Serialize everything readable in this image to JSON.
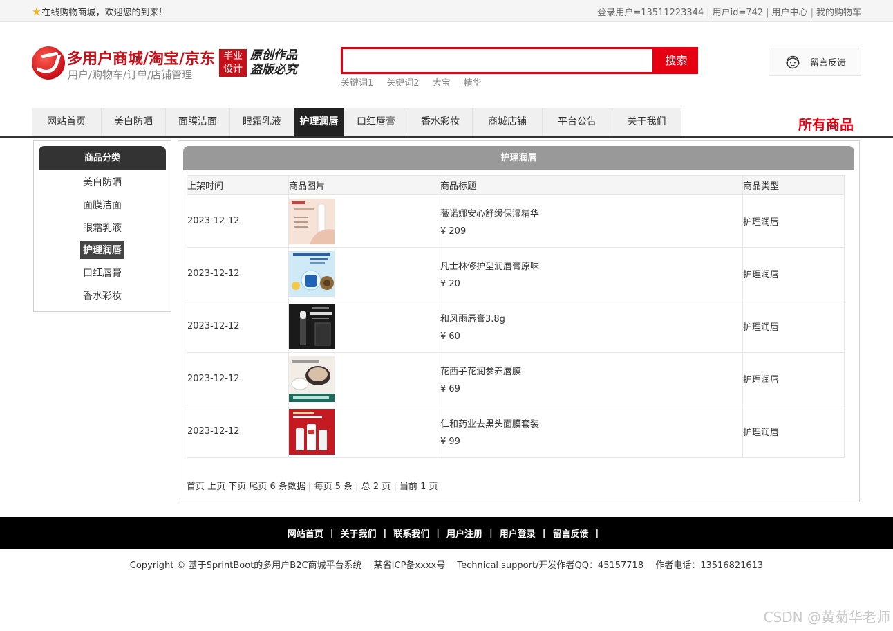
{
  "topbar": {
    "welcome": "在线购物商城，欢迎您的到来!",
    "login_user": "登录用户=13511223344",
    "user_id": "用户id=742",
    "user_center": "用户中心",
    "my_cart": "我的购物车"
  },
  "header": {
    "site_title": "多用户商城/淘宝/京东",
    "site_sub": "用户/购物车/订单/店铺管理",
    "badge_line1": "毕业",
    "badge_line2": "设计",
    "script_line1": "原创作品",
    "script_line2": "盗版必究",
    "search_placeholder": "",
    "search_button": "搜索",
    "hot_words": [
      "关键词1",
      "关键词2",
      "大宝",
      "精华"
    ],
    "feedback": "留言反馈"
  },
  "nav": {
    "items": [
      "网站首页",
      "美白防晒",
      "面膜洁面",
      "眼霜乳液",
      "护理润唇",
      "口红唇膏",
      "香水彩妆",
      "商城店铺",
      "平台公告",
      "关于我们"
    ],
    "active_index": 4,
    "all_goods": "所有商品"
  },
  "sidebar": {
    "title": "商品分类",
    "categories": [
      "美白防晒",
      "面膜洁面",
      "眼霜乳液",
      "护理润唇",
      "口红唇膏",
      "香水彩妆"
    ],
    "active_index": 3
  },
  "main": {
    "title": "护理润唇",
    "columns": [
      "上架时间",
      "商品图片",
      "商品标题",
      "商品类型"
    ],
    "rows": [
      {
        "date": "2023-12-12",
        "title": "薇诺娜安心舒缓保湿精华",
        "price": "¥ 209",
        "type": "护理润唇"
      },
      {
        "date": "2023-12-12",
        "title": "凡士林修护型润唇膏原味",
        "price": "¥ 20",
        "type": "护理润唇"
      },
      {
        "date": "2023-12-12",
        "title": "和风雨唇膏3.8g",
        "price": "¥ 60",
        "type": "护理润唇"
      },
      {
        "date": "2023-12-12",
        "title": "花西子花润参养唇膜",
        "price": "¥ 69",
        "type": "护理润唇"
      },
      {
        "date": "2023-12-12",
        "title": "仁和药业去黑头面膜套装",
        "price": "¥ 99",
        "type": "护理润唇"
      }
    ],
    "pager": "首页 上页 下页 尾页 6 条数据 | 每页 5 条 | 总 2 页 | 当前 1 页"
  },
  "footer": {
    "links": [
      "网站首页",
      "关于我们",
      "联系我们",
      "用户注册",
      "用户登录",
      "留言反馈"
    ],
    "copyright": "Copyright © 基于SprintBoot的多用户B2C商城平台系统　 某省ICP备xxxx号　 Technical support/开发作者QQ：45157718　  作者电话：13516821613",
    "watermark": "CSDN @黄菊华老师"
  }
}
